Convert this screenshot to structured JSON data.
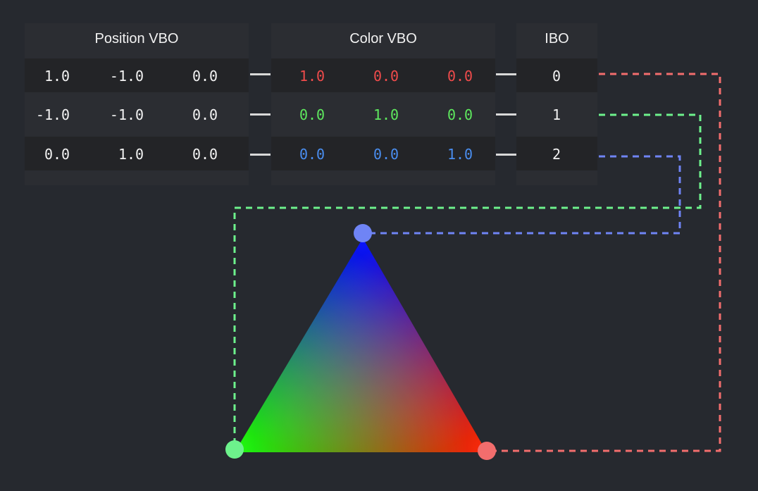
{
  "headers": {
    "position": "Position VBO",
    "color": "Color VBO",
    "ibo": "IBO"
  },
  "position_rows": [
    [
      "1.0",
      "-1.0",
      "0.0"
    ],
    [
      "-1.0",
      "-1.0",
      "0.0"
    ],
    [
      "0.0",
      "1.0",
      "0.0"
    ]
  ],
  "color_rows": [
    [
      "1.0",
      "0.0",
      "0.0"
    ],
    [
      "0.0",
      "1.0",
      "0.0"
    ],
    [
      "0.0",
      "0.0",
      "1.0"
    ]
  ],
  "ibo_rows": [
    "0",
    "1",
    "2"
  ],
  "colors": {
    "background": "#26292f",
    "red": "#f26d6d",
    "green": "#6df28c",
    "blue": "#6f84f5",
    "text_white": "#f2f2f2",
    "red_text": "#ef4b4b",
    "green_text": "#5ee85e",
    "blue_text": "#4a8ef0"
  }
}
